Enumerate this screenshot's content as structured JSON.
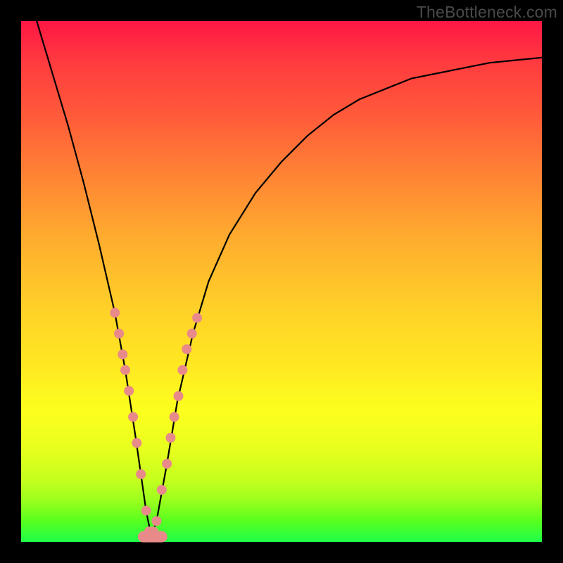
{
  "watermark": "TheBottleneck.com",
  "chart_data": {
    "type": "line",
    "title": "",
    "xlabel": "",
    "ylabel": "",
    "xlim": [
      0,
      100
    ],
    "ylim": [
      0,
      100
    ],
    "optimum_x": 25,
    "series": [
      {
        "name": "bottleneck-curve",
        "x": [
          3,
          6,
          9,
          12,
          15,
          18,
          20,
          22,
          24,
          25,
          26,
          28,
          30,
          33,
          36,
          40,
          45,
          50,
          55,
          60,
          65,
          70,
          75,
          80,
          85,
          90,
          95,
          100
        ],
        "values": [
          100,
          90,
          80,
          69,
          57,
          44,
          33,
          20,
          6,
          1,
          4,
          15,
          27,
          40,
          50,
          59,
          67,
          73,
          78,
          82,
          85,
          87,
          89,
          90,
          91,
          92,
          92.5,
          93
        ]
      }
    ],
    "markers": {
      "name": "sample-dots",
      "color": "#e88a8a",
      "points": [
        {
          "x": 18.0,
          "y": 44
        },
        {
          "x": 18.8,
          "y": 40
        },
        {
          "x": 19.5,
          "y": 36
        },
        {
          "x": 20.0,
          "y": 33
        },
        {
          "x": 20.7,
          "y": 29
        },
        {
          "x": 21.5,
          "y": 24
        },
        {
          "x": 22.2,
          "y": 19
        },
        {
          "x": 23.0,
          "y": 13
        },
        {
          "x": 24.0,
          "y": 6
        },
        {
          "x": 24.6,
          "y": 2
        },
        {
          "x": 25.4,
          "y": 2
        },
        {
          "x": 26.0,
          "y": 4
        },
        {
          "x": 27.0,
          "y": 10
        },
        {
          "x": 28.0,
          "y": 15
        },
        {
          "x": 28.7,
          "y": 20
        },
        {
          "x": 29.4,
          "y": 24
        },
        {
          "x": 30.2,
          "y": 28
        },
        {
          "x": 31.0,
          "y": 33
        },
        {
          "x": 31.8,
          "y": 37
        },
        {
          "x": 32.8,
          "y": 40
        },
        {
          "x": 33.8,
          "y": 43
        }
      ]
    },
    "bottom_bar": {
      "name": "optimum-zone",
      "color": "#e88a8a",
      "x_start": 23.5,
      "x_end": 27.0,
      "y": 1
    }
  }
}
